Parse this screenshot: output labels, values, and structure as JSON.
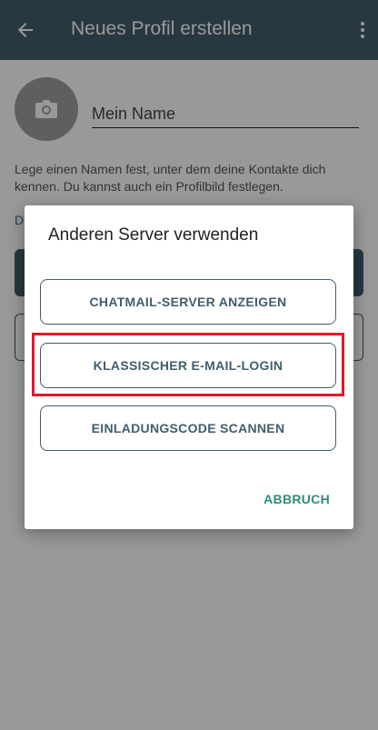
{
  "appbar": {
    "title": "Neues Profil erstellen"
  },
  "profile": {
    "name_placeholder": "Mein Name",
    "hint": "Lege einen Namen fest, unter dem deine Kontakte dich kennen. Du kannst auch ein Profilbild festlegen.",
    "partial_link": "D"
  },
  "dialog": {
    "title": "Anderen Server verwenden",
    "buttons": [
      {
        "label": "CHATMAIL-SERVER ANZEIGEN"
      },
      {
        "label": "KLASSISCHER E-MAIL-LOGIN"
      },
      {
        "label": "EINLADUNGSCODE SCANNEN"
      }
    ],
    "cancel_label": "ABBRUCH",
    "highlight_color": "#e2172b"
  },
  "colors": {
    "primary": "#415e6b",
    "accent": "#2e8b7a"
  }
}
